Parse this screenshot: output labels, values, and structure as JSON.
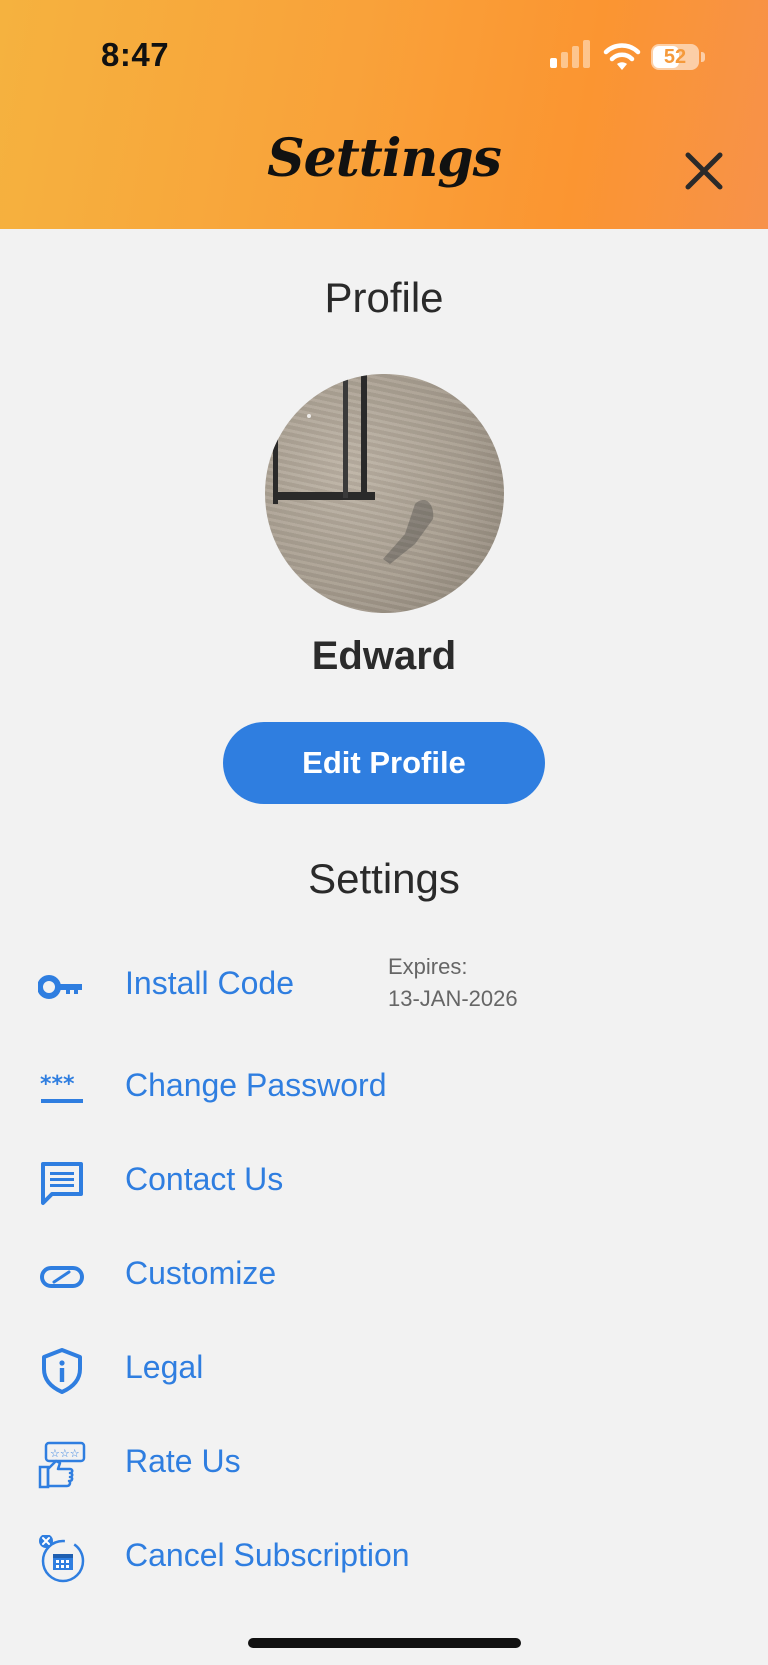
{
  "status_bar": {
    "time": "8:47",
    "battery": "52"
  },
  "header": {
    "title": "Settings"
  },
  "profile": {
    "section_title": "Profile",
    "name": "Edward",
    "edit_button": "Edit Profile"
  },
  "settings": {
    "section_title": "Settings",
    "items": [
      {
        "label": "Install Code",
        "icon": "key-icon",
        "expires_label": "Expires:",
        "expires_date": "13-JAN-2026"
      },
      {
        "label": "Change Password",
        "icon": "password-icon"
      },
      {
        "label": "Contact Us",
        "icon": "chat-icon"
      },
      {
        "label": "Customize",
        "icon": "toggle-icon"
      },
      {
        "label": "Legal",
        "icon": "shield-info-icon"
      },
      {
        "label": "Rate Us",
        "icon": "thumbs-up-rating-icon"
      },
      {
        "label": "Cancel Subscription",
        "icon": "cancel-calendar-icon"
      }
    ]
  },
  "colors": {
    "accent": "#2f7ee0",
    "header_start": "#f5b23f",
    "header_end": "#fb9531",
    "background": "#f2f2f2"
  }
}
